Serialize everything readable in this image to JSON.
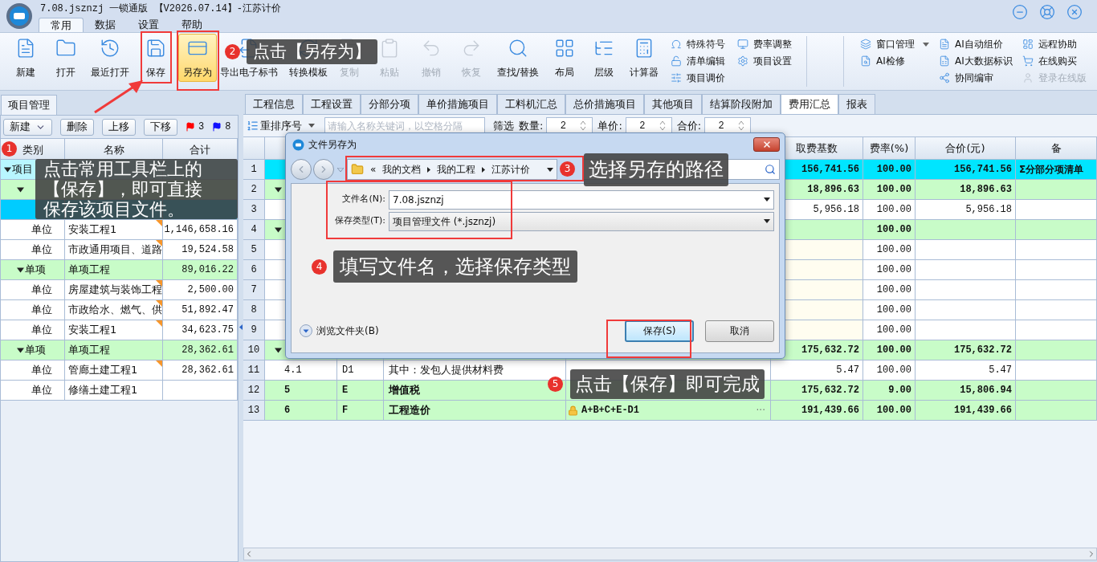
{
  "window": {
    "title": "7.08.jsznzj 一锁通版 【V2026.07.14】-江苏计价"
  },
  "menu_tabs": [
    {
      "label": "常用",
      "selected": true
    },
    {
      "label": "数据",
      "selected": false
    },
    {
      "label": "设置",
      "selected": false
    },
    {
      "label": "帮助",
      "selected": false
    }
  ],
  "toolbar": {
    "buttons": [
      {
        "label": "新建",
        "disabled": false,
        "selected": false
      },
      {
        "label": "打开",
        "disabled": false,
        "selected": false
      },
      {
        "label": "最近打开",
        "disabled": false,
        "selected": false
      },
      {
        "label": "保存",
        "disabled": false,
        "selected": false
      },
      {
        "label": "另存为",
        "disabled": false,
        "selected": true
      },
      {
        "label": "导出电子标书",
        "disabled": false,
        "selected": false
      },
      {
        "label": "转换模板",
        "disabled": false,
        "selected": false
      },
      {
        "label": "复制",
        "disabled": true,
        "selected": false
      },
      {
        "label": "粘贴",
        "disabled": true,
        "selected": false
      },
      {
        "label": "撤销",
        "disabled": true,
        "selected": false
      },
      {
        "label": "恢复",
        "disabled": true,
        "selected": false
      },
      {
        "label": "查找/替换",
        "disabled": false,
        "selected": false
      },
      {
        "label": "布局",
        "disabled": false,
        "selected": false
      },
      {
        "label": "层级",
        "disabled": false,
        "selected": false
      },
      {
        "label": "计算器",
        "disabled": false,
        "selected": false
      }
    ],
    "small_columns": [
      [
        {
          "label": "特殊符号",
          "disabled": false
        },
        {
          "label": "清单编辑",
          "disabled": false
        },
        {
          "label": "项目调价",
          "disabled": false
        }
      ],
      [
        {
          "label": "费率调整",
          "disabled": false
        },
        {
          "label": "项目设置",
          "disabled": false
        }
      ]
    ],
    "right_columns": [
      [
        {
          "label": "窗口管理",
          "disabled": false,
          "dropdown": true
        },
        {
          "label": "AI检修",
          "disabled": false,
          "dropdown": false
        }
      ],
      [
        {
          "label": "AI自动组价",
          "disabled": false,
          "dropdown": false
        },
        {
          "label": "AI大数据标识",
          "disabled": false,
          "dropdown": false
        },
        {
          "label": "协同编审",
          "disabled": false,
          "dropdown": false
        }
      ],
      [
        {
          "label": "远程协助",
          "disabled": false,
          "dropdown": false
        },
        {
          "label": "在线购买",
          "disabled": false,
          "dropdown": false
        },
        {
          "label": "登录在线版",
          "disabled": true,
          "dropdown": false
        }
      ]
    ]
  },
  "project_panel": {
    "tab": "项目管理",
    "buttons": [
      {
        "label": "新建",
        "dropdown": true
      },
      {
        "label": "删除",
        "dropdown": false
      },
      {
        "label": "上移",
        "dropdown": false
      },
      {
        "label": "下移",
        "dropdown": false
      }
    ],
    "flags": [
      {
        "color": "#ff0000",
        "count": "3"
      },
      {
        "color": "#1010ff",
        "count": "8"
      }
    ],
    "columns": [
      "类别",
      "名称",
      "合计"
    ],
    "tree": [
      {
        "kind": "project",
        "type": "项目",
        "selected": false,
        "expanded": true,
        "children": [
          {
            "kind": "single",
            "selected": false,
            "expanded": true,
            "children": [
              {
                "kind": "unit",
                "selected": true
              },
              {
                "kind": "unit",
                "type": "单位",
                "name": "安装工程1",
                "total": "1,146,658.16",
                "selected": false,
                "marked": true
              },
              {
                "kind": "unit",
                "type": "单位",
                "name": "市政通用项目、道路",
                "total": "19,524.58",
                "selected": false,
                "marked": true
              }
            ]
          },
          {
            "kind": "single",
            "type": "单项",
            "name": "单项工程",
            "total": "89,016.22",
            "selected": false,
            "expanded": true,
            "children": [
              {
                "kind": "unit",
                "type": "单位",
                "name": "房屋建筑与装饰工程",
                "total": "2,500.00",
                "selected": false,
                "marked": true
              },
              {
                "kind": "unit",
                "type": "单位",
                "name": "市政给水、燃气、供",
                "total": "51,892.47",
                "selected": false,
                "marked": true
              },
              {
                "kind": "unit",
                "type": "单位",
                "name": "安装工程1",
                "total": "34,623.75",
                "selected": false,
                "marked": true
              }
            ]
          },
          {
            "kind": "single",
            "type": "单项",
            "name": "单项工程",
            "total": "28,362.61",
            "selected": false,
            "expanded": true,
            "children": [
              {
                "kind": "unit",
                "type": "单位",
                "name": "管廊土建工程1",
                "total": "28,362.61",
                "selected": false,
                "marked": true
              },
              {
                "kind": "unit",
                "type": "单位",
                "name": "修缮土建工程1",
                "selected": false,
                "marked": false
              }
            ]
          }
        ]
      }
    ]
  },
  "sheet_tabs": [
    {
      "label": "工程信息",
      "selected": false
    },
    {
      "label": "工程设置",
      "selected": false
    },
    {
      "label": "分部分项",
      "selected": false
    },
    {
      "label": "单价措施项目",
      "selected": false
    },
    {
      "label": "工料机汇总",
      "selected": false
    },
    {
      "label": "总价措施项目",
      "selected": false
    },
    {
      "label": "其他项目",
      "selected": false
    },
    {
      "label": "结算阶段附加",
      "selected": false
    },
    {
      "label": "费用汇总",
      "selected": true
    },
    {
      "label": "报表",
      "selected": false
    }
  ],
  "filter_bar": {
    "sort_button": "重排序号",
    "search_placeholder": "请输入名称关键词，以空格分隔",
    "filter_label": "筛选",
    "spinners": [
      {
        "label": "数量:",
        "value": "2"
      },
      {
        "label": "单价:",
        "value": "2"
      },
      {
        "label": "合价:",
        "value": "2"
      }
    ]
  },
  "fee_table": {
    "columns": [
      "取费基数",
      "费率(%)",
      "合价(元)",
      "备"
    ],
    "rows": [
      {
        "no": "1",
        "kind": "group",
        "selected": true,
        "base": "156,741.56",
        "rate": "100.00",
        "amount": "156,741.56",
        "note": "Σ分部分项清单"
      },
      {
        "no": "2",
        "kind": "group",
        "selected": false,
        "expanded": true,
        "base": "18,896.63",
        "rate": "100.00",
        "amount": "18,896.63"
      },
      {
        "no": "3",
        "kind": "item",
        "selected": false,
        "base": "5,956.18",
        "rate": "100.00",
        "amount": "5,956.18"
      },
      {
        "no": "4",
        "kind": "group",
        "selected": false,
        "expanded": true,
        "rate": "100.00"
      },
      {
        "no": "5",
        "kind": "blank",
        "selected": false,
        "rate": "100.00"
      },
      {
        "no": "6",
        "kind": "blank",
        "selected": false,
        "rate": "100.00"
      },
      {
        "no": "7",
        "kind": "blank",
        "selected": false,
        "rate": "100.00"
      },
      {
        "no": "8",
        "kind": "blank",
        "selected": false,
        "rate": "100.00"
      },
      {
        "no": "9",
        "kind": "blank",
        "selected": false,
        "rate": "100.00"
      },
      {
        "no": "10",
        "kind": "group",
        "selected": false,
        "expanded": true,
        "base": "175,632.72",
        "rate": "100.00",
        "amount": "175,632.72"
      },
      {
        "no": "11",
        "kind": "item",
        "selected": false,
        "seq": "4.1",
        "code": "D1",
        "name": "其中：发包人提供材料费",
        "base": "5.47",
        "rate": "100.00",
        "amount": "5.47"
      },
      {
        "no": "12",
        "kind": "group",
        "selected": false,
        "seq": "5",
        "code": "E",
        "name": "增值税",
        "base": "175,632.72",
        "rate": "9.00",
        "amount": "15,806.94"
      },
      {
        "no": "13",
        "kind": "group",
        "selected": false,
        "seq": "6",
        "code": "F",
        "name": "工程造价",
        "locked": true,
        "calc": "A+B+C+E-D1",
        "more": "···",
        "base": "191,439.66",
        "rate": "100.00",
        "amount": "191,439.66"
      }
    ]
  },
  "dialog": {
    "title": "文件另存为",
    "path_prefix": "«",
    "path": [
      "我的文档",
      "我的工程",
      "江苏计价"
    ],
    "fields": [
      {
        "kind": "input",
        "label": "文件名(N):",
        "value": "7.08.jsznzj"
      },
      {
        "kind": "select",
        "label": "保存类型(T):",
        "value": "项目管理文件 (*.jsznzj)"
      }
    ],
    "browse": "浏览文件夹(B)",
    "buttons": [
      {
        "label": "保存(S)",
        "default": true
      },
      {
        "label": "取消",
        "default": false
      }
    ]
  },
  "callouts": [
    {
      "number": "1",
      "text": "点击常用工具栏上的【保存】，即可直接保存该项目文件。"
    },
    {
      "number": "2",
      "text": "点击【另存为】"
    },
    {
      "number": "3",
      "text": "选择另存的路径"
    },
    {
      "number": "4",
      "text": "填写文件名，选择保存类型"
    },
    {
      "number": "5",
      "text": "点击【保存】即可完成"
    }
  ]
}
